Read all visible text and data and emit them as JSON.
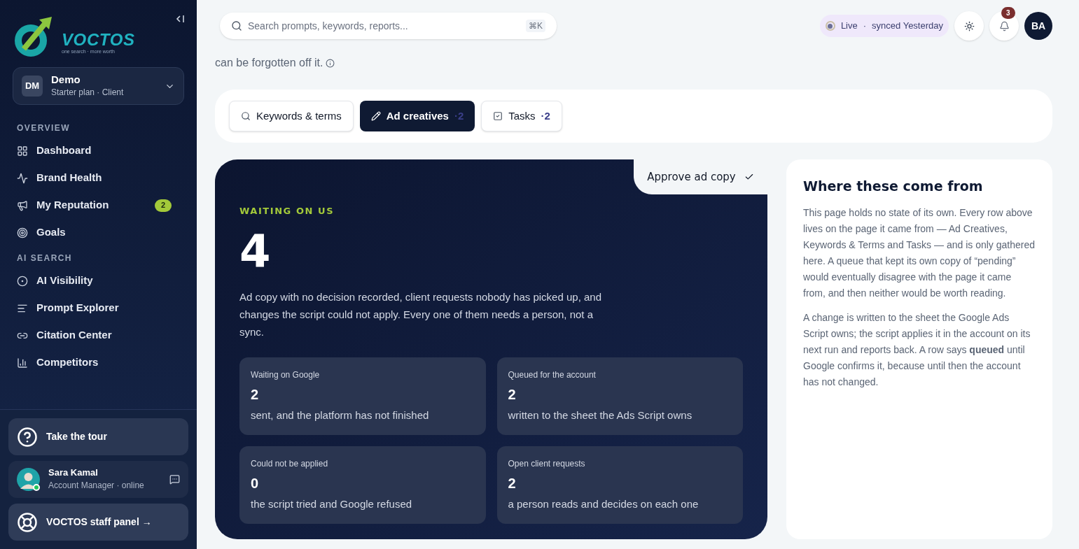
{
  "logo": {
    "name": "VOCTOS",
    "tagline": "one search · more worth"
  },
  "workspace": {
    "initials": "DM",
    "name": "Demo",
    "plan": "Starter plan · Client"
  },
  "sidebar": {
    "sections": [
      {
        "title": "OVERVIEW",
        "items": [
          {
            "label": "Dashboard",
            "kind": "grid"
          },
          {
            "label": "Brand Health",
            "kind": "health"
          },
          {
            "label": "My Reputation",
            "kind": "megaphone",
            "badge": "2"
          },
          {
            "label": "Goals",
            "kind": "target"
          }
        ]
      },
      {
        "title": "AI SEARCH",
        "items": [
          {
            "label": "AI Visibility",
            "kind": "dot"
          },
          {
            "label": "Prompt Explorer",
            "kind": "lines"
          },
          {
            "label": "Citation Center",
            "kind": "link"
          },
          {
            "label": "Competitors",
            "kind": "bars"
          }
        ]
      }
    ]
  },
  "tour": {
    "label": "Take the tour"
  },
  "manager": {
    "name": "Sara Kamal",
    "role": "Account Manager · online",
    "online": true
  },
  "staff_panel": {
    "label": "VOCTOS staff panel →"
  },
  "search": {
    "placeholder": "Search prompts, keywords, reports...",
    "shortcut": "⌘K"
  },
  "sync": {
    "status": "Live",
    "separator": "·",
    "text": "synced Yesterday"
  },
  "notifications": {
    "count": "3"
  },
  "user": {
    "initials": "BA"
  },
  "intro": "can be forgotten off it.",
  "tabs": [
    {
      "label": "Keywords & terms",
      "kind": "search",
      "selected": false
    },
    {
      "label": "Ad creatives",
      "count": "·2",
      "kind": "edit",
      "selected": true
    },
    {
      "label": "Tasks",
      "count": "·2",
      "kind": "check",
      "selected": false
    }
  ],
  "summary": {
    "corner_action": "Approve ad copy",
    "eyebrow": "WAITING ON US",
    "total": "4",
    "description": "Ad copy with no decision recorded, client requests nobody has picked up, and changes the script could not apply. Every one of them needs a person, not a sync.",
    "stats": [
      {
        "title": "Waiting on Google",
        "value": "2",
        "note": "sent, and the platform has not finished"
      },
      {
        "title": "Queued for the account",
        "value": "2",
        "note": "written to the sheet the Ads Script owns"
      },
      {
        "title": "Could not be applied",
        "value": "0",
        "note": "the script tried and Google refused"
      },
      {
        "title": "Open client requests",
        "value": "2",
        "note": "a person reads and decides on each one"
      }
    ]
  },
  "info": {
    "title": "Where these come from",
    "paragraphs": [
      "This page holds no state of its own. Every row above lives on the page it came from — Ad Creatives, Keywords & Terms and Tasks — and is only gathered here. A queue that kept its own copy of “pending” would eventually disagree with the page it came from, and then neither would be worth reading.",
      "A change is written to the sheet the Google Ads Script owns; the script applies it in the account on its next run and reports back. A row says **queued** until Google confirms it, because until then the account has not changed."
    ]
  }
}
